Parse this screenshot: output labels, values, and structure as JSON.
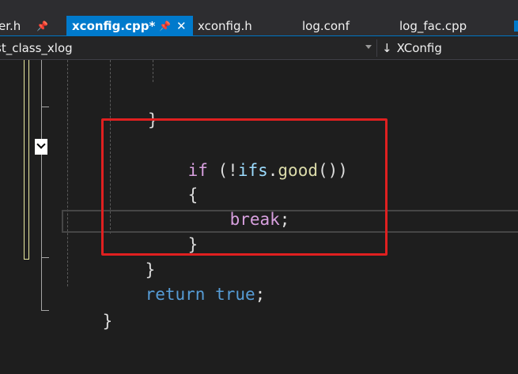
{
  "tabs": [
    {
      "label": "er.h",
      "pinned": true,
      "active": false
    },
    {
      "label": "xconfig.cpp*",
      "pinned": true,
      "active": true,
      "closable": true
    },
    {
      "label": "xconfig.h",
      "active": false
    },
    {
      "label": "log.conf",
      "active": false
    },
    {
      "label": "log_fac.cpp",
      "active": false
    }
  ],
  "icons": {
    "pin": "pin-icon",
    "close": "close-icon",
    "member": "member-arrow-icon"
  },
  "navbar": {
    "scope": "st_class_xlog",
    "member_icon": "↓",
    "member": "XConfig"
  },
  "code": {
    "close_brace_inner": "}",
    "if_kw": "if",
    "if_open": " (!",
    "if_var": "ifs",
    "if_dot": ".",
    "if_fn": "good",
    "if_close": "())",
    "open_brace": "{",
    "break_kw": "break",
    "semicolon": ";",
    "close_brace": "}",
    "close_brace_outer": "}",
    "return_kw": "return",
    "true_kw": "true",
    "func_close": "}"
  },
  "colors": {
    "tab_active_bg": "#007acc",
    "highlight_box": "#e02020",
    "keyword_control": "#d8a0df",
    "keyword": "#569cd6",
    "variable": "#9cdcfe",
    "function": "#dcdcaa"
  }
}
